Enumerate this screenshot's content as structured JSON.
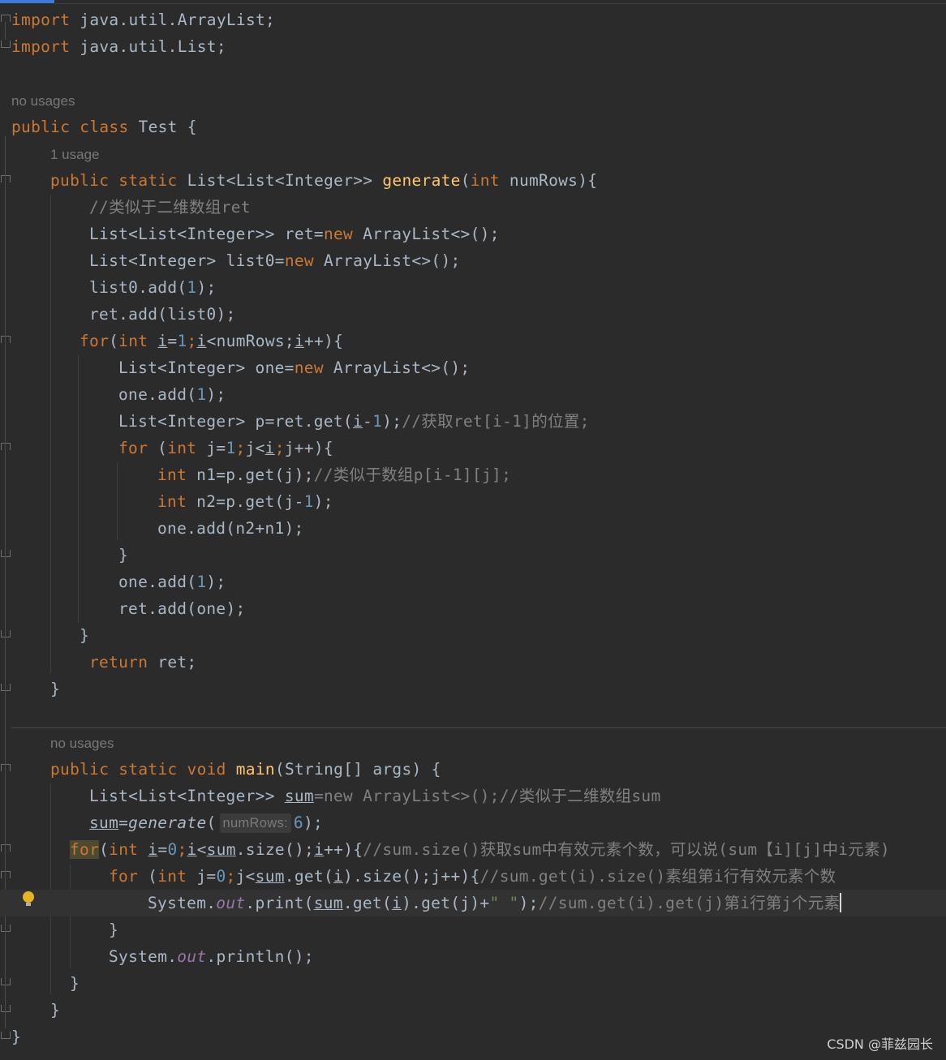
{
  "editor": {
    "import1": [
      "import",
      " java.util.ArrayList;"
    ],
    "import2": [
      "import",
      " java.util.List;"
    ],
    "hint_no_usages_1": "no usages",
    "class_decl": [
      "public class ",
      "Test {"
    ],
    "hint_1_usage": "1 usage",
    "gen_sig": [
      "public static ",
      "List<List<Integer>> ",
      "generate",
      "(",
      "int ",
      "numRows){"
    ],
    "c1": "//类似于二维数组ret",
    "l_ret": [
      "List<List<Integer>> ret=",
      "new ",
      "ArrayList<>();"
    ],
    "l_list0": [
      "List<Integer> list0=",
      "new ",
      "ArrayList<>();"
    ],
    "l_add1": [
      "list0.add(",
      "1",
      ");"
    ],
    "l_retadd": [
      "ret.add(list0);"
    ],
    "l_for1": [
      "for",
      "(",
      "int ",
      "i",
      "=",
      "1",
      ";",
      "i",
      "<numRows;",
      "i",
      "++){"
    ],
    "l_one": [
      "List<Integer> one=",
      "new ",
      "ArrayList<>();"
    ],
    "l_oneadd": [
      "one.add(",
      "1",
      ");"
    ],
    "l_p": [
      "List<Integer> p=ret.get(",
      "i",
      "-",
      "1",
      ");",
      "//获取ret[i-1]的位置;"
    ],
    "l_for2": [
      "for ",
      "(",
      "int ",
      "j=",
      "1",
      ";",
      "j<",
      "i",
      ";",
      "j++){"
    ],
    "l_n1": [
      "int ",
      "n1=p.get(j);",
      "//类似于数组p[i-1][j];"
    ],
    "l_n2": [
      "int ",
      "n2=p.get(j-",
      "1",
      ");"
    ],
    "l_oneadd2": [
      "one.add(n2+n1);"
    ],
    "l_brace": "}",
    "l_oneadd3": [
      "one.add(",
      "1",
      ");"
    ],
    "l_retadd2": [
      "ret.add(one);"
    ],
    "l_return": [
      "return ",
      "ret;"
    ],
    "hint_no_usages_2": "no usages",
    "main_sig": [
      "public static void ",
      "main",
      "(String[] args) {"
    ],
    "l_sum": [
      "List<List<Integer>> ",
      "sum",
      "=new ArrayList<>();",
      "//类似于二维数组sum"
    ],
    "l_sumgen": [
      "sum",
      "=",
      "generate",
      "(",
      "numRows:",
      "6",
      ");"
    ],
    "l_for3": [
      "for",
      "(",
      "int ",
      "i",
      "=",
      "0",
      ";",
      "i",
      "<",
      "sum",
      ".size();",
      "i",
      "++){",
      "//sum.size()获取sum中有效元素个数，可以说(sum【i][j]中i元素)"
    ],
    "l_for4": [
      "for ",
      "(",
      "int ",
      "j=",
      "0",
      ";",
      "j<",
      "sum",
      ".get(",
      "i",
      ").size();",
      "j++){",
      "//sum.get(i).size()素组第i行有效元素个数"
    ],
    "l_print": [
      "System.",
      "out",
      ".print(",
      "sum",
      ".get(",
      "i",
      ").get(j)+",
      "\" \"",
      ");",
      "//sum.get(i).get(j)第i行第j个元素"
    ],
    "l_println": [
      "System.",
      "out",
      ".println();"
    ],
    "close": "}"
  },
  "watermark": "CSDN @菲兹园长",
  "colors": {
    "background": "#2b2b2b",
    "keyword": "#cc7832",
    "function": "#ffc66d",
    "number": "#6897bb",
    "comment": "#808080",
    "string": "#6a8759",
    "field": "#9876aa",
    "text": "#a9b7c6"
  },
  "icons": {
    "intention": "lightbulb-icon",
    "fold": "fold-marker-icon"
  }
}
